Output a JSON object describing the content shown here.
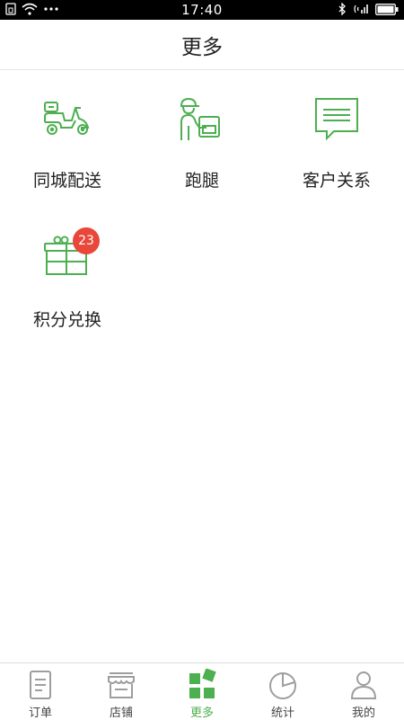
{
  "status_bar": {
    "time": "17:40"
  },
  "header": {
    "title": "更多"
  },
  "tiles": [
    {
      "label": "同城配送",
      "icon": "scooter-icon"
    },
    {
      "label": "跑腿",
      "icon": "courier-icon"
    },
    {
      "label": "客户关系",
      "icon": "chat-icon"
    },
    {
      "label": "积分兑换",
      "icon": "gift-icon",
      "badge": "23"
    }
  ],
  "tabs": [
    {
      "label": "订单",
      "icon": "order-doc-icon"
    },
    {
      "label": "店铺",
      "icon": "store-icon"
    },
    {
      "label": "更多",
      "icon": "more-blocks-icon",
      "active": true
    },
    {
      "label": "统计",
      "icon": "pie-chart-icon"
    },
    {
      "label": "我的",
      "icon": "person-icon"
    }
  ],
  "colors": {
    "accent": "#4caf50",
    "badge": "#e8473a",
    "inactive_icon": "#9e9e9e"
  }
}
